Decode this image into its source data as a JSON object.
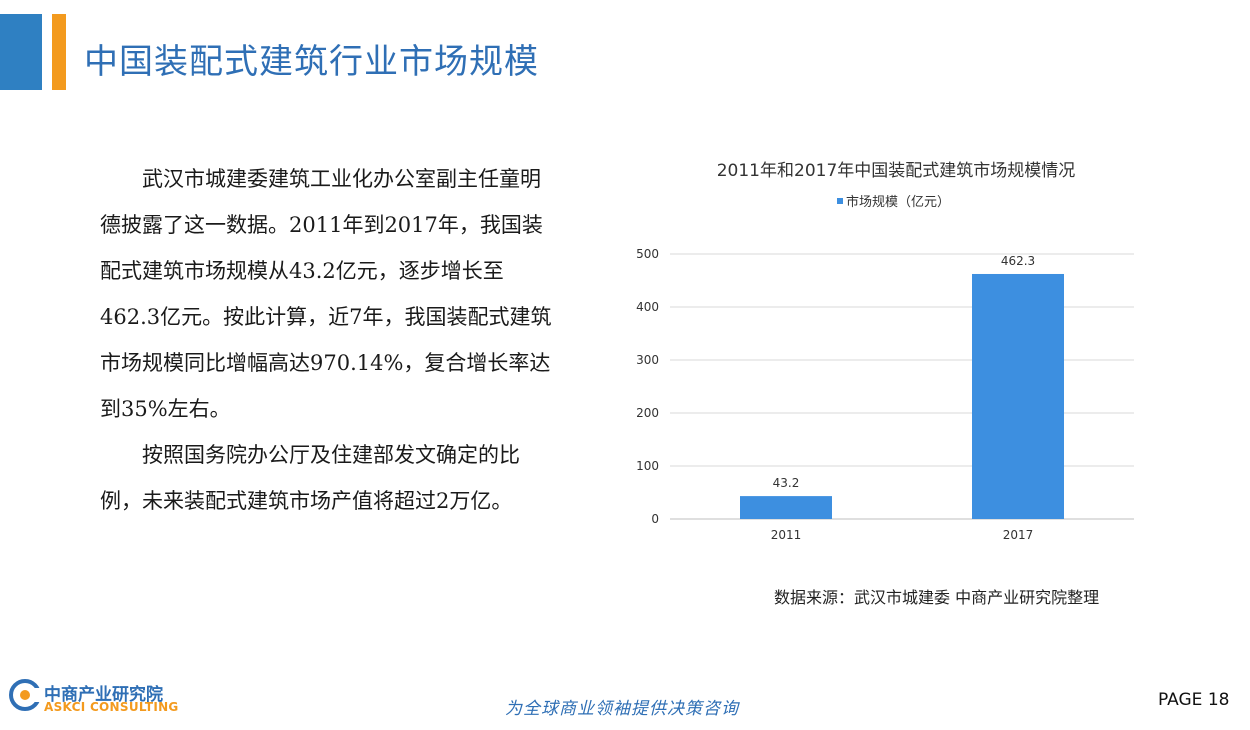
{
  "page": {
    "title": "中国装配式建筑行业市场规模",
    "page_label": "PAGE",
    "page_number": "18"
  },
  "body": {
    "paragraphs": [
      "武汉市城建委建筑工业化办公室副主任童明德披露了这一数据。2011年到2017年，我国装配式建筑市场规模从43.2亿元，逐步增长至462.3亿元。按此计算，近7年，我国装配式建筑市场规模同比增幅高达970.14%，复合增长率达到35%左右。",
      "按照国务院办公厅及住建部发文确定的比例，未来装配式建筑市场产值将超过2万亿。"
    ]
  },
  "source": "数据来源：武汉市城建委 中商产业研究院整理",
  "footer": {
    "logo_cn": "中商产业研究院",
    "logo_en": "ASKCI CONSULTING",
    "slogan": "为全球商业领袖提供决策咨询"
  },
  "colors": {
    "accent_blue": "#2F80C2",
    "accent_orange": "#F39A1E",
    "bar": "#3D8FE0"
  },
  "chart_data": {
    "type": "bar",
    "title": "2011年和2017年中国装配式建筑市场规模情况",
    "categories": [
      "2011",
      "2017"
    ],
    "series": [
      {
        "name": "市场规模（亿元）",
        "values": [
          43.2,
          462.3
        ]
      }
    ],
    "data_labels": [
      "43.2",
      "462.3"
    ],
    "ylim": [
      0,
      500
    ],
    "yticks": [
      0,
      100,
      200,
      300,
      400,
      500
    ],
    "grid": true,
    "legend": "top-center"
  }
}
